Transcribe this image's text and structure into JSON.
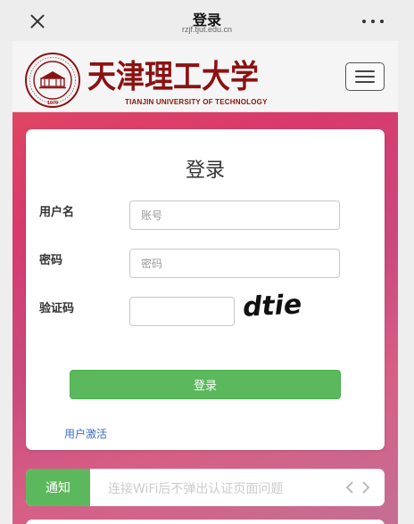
{
  "topbar": {
    "title": "登录",
    "domain": "rzjf.tjut.edu.cn"
  },
  "header": {
    "university_name": "天津理工大学",
    "university_name_en": "TIANJIN UNIVERSITY OF TECHNOLOGY",
    "seal_year": "1979",
    "brand_color": "#8b1212"
  },
  "login": {
    "title": "登录",
    "username_label": "用户名",
    "username_placeholder": "账号",
    "username_value": "",
    "password_label": "密码",
    "password_placeholder": "密码",
    "password_value": "",
    "captcha_label": "验证码",
    "captcha_value": "",
    "captcha_image_text": "dtie",
    "submit_label": "登录",
    "activate_link": "用户激活"
  },
  "notice": {
    "tag": "通知",
    "text": "连接WiFi后不弹出认证页面问题"
  },
  "colors": {
    "accent_green": "#5cb85c",
    "link_blue": "#3a6fc4"
  },
  "icons": {
    "close": "close-icon",
    "more": "more-icon",
    "menu": "hamburger-icon",
    "prev": "chevron-left-icon",
    "next": "chevron-right-icon"
  }
}
